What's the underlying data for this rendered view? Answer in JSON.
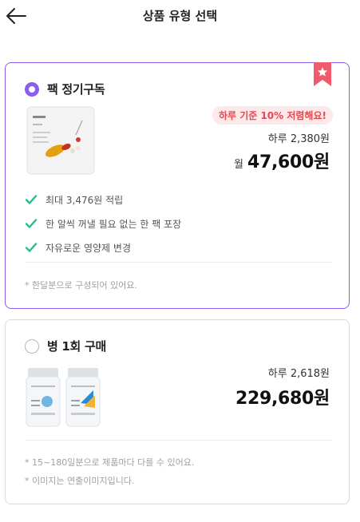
{
  "header": {
    "title": "상품 유형 선택",
    "back_icon": "arrow-left-icon"
  },
  "colors": {
    "accent": "#8a5cf0",
    "ribbon": "#f05a6a",
    "check": "#1fc08a",
    "promo_text": "#e8474f",
    "promo_bg": "#fde9ea"
  },
  "pack_option": {
    "selected": true,
    "title": "팩 정기구독",
    "badge_icon": "star-ribbon-icon",
    "promo": "하루 기준 10% 저렴해요!",
    "daily_price": "하루 2,380원",
    "monthly_prefix": "월",
    "monthly_price": "47,600원",
    "benefits": [
      "최대 3,476원 적립",
      "한 알씩 꺼낼 필요 없는 한 팩 포장",
      "자유로운 영양제 변경"
    ],
    "note": "* 한달분으로 구성되어 있어요."
  },
  "bottle_option": {
    "selected": false,
    "title": "병 1회 구매",
    "daily_price": "하루 2,618원",
    "total_price": "229,680원",
    "notes": [
      "* 15~180일분으로 제품마다 다를 수 있어요.",
      "* 이미지는 연출이미지입니다."
    ]
  }
}
